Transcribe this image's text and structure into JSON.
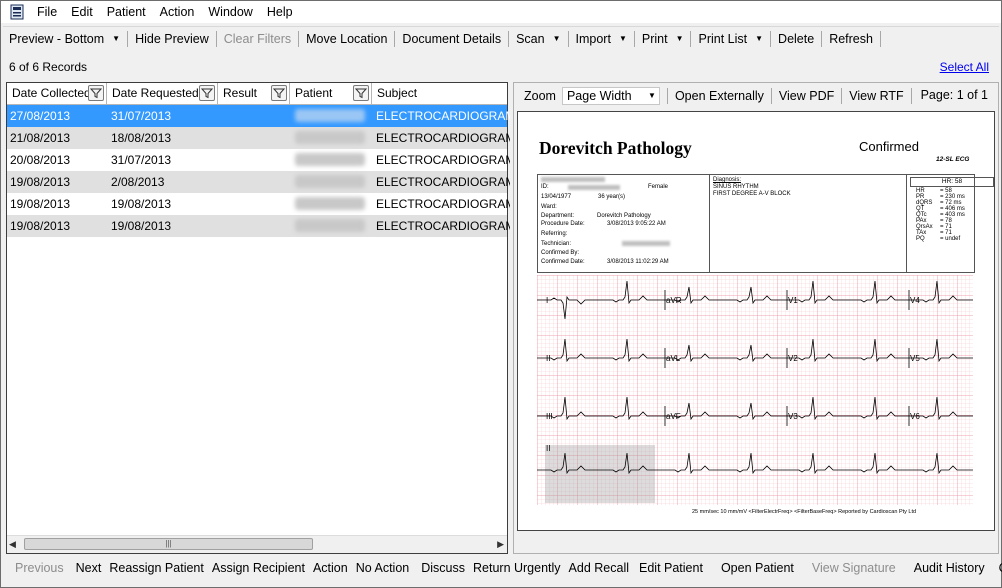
{
  "menu": [
    "File",
    "Edit",
    "Patient",
    "Action",
    "Window",
    "Help"
  ],
  "toolbar": {
    "preview": "Preview - Bottom",
    "hide_preview": "Hide Preview",
    "clear_filters": "Clear Filters",
    "move_location": "Move Location",
    "document_details": "Document Details",
    "scan": "Scan",
    "import": "Import",
    "print": "Print",
    "print_list": "Print List",
    "delete": "Delete",
    "refresh": "Refresh"
  },
  "records": {
    "count": "6 of 6 Records",
    "select_all": "Select All"
  },
  "grid": {
    "columns": [
      "Date Collected",
      "Date Requested",
      "Result",
      "Patient",
      "Subject"
    ],
    "rows": [
      {
        "collected": "27/08/2013",
        "requested": "31/07/2013",
        "result": "",
        "subject": "ELECTROCARDIOGRAM"
      },
      {
        "collected": "21/08/2013",
        "requested": "18/08/2013",
        "result": "",
        "subject": "ELECTROCARDIOGRAM"
      },
      {
        "collected": "20/08/2013",
        "requested": "31/07/2013",
        "result": "",
        "subject": "ELECTROCARDIOGRAM"
      },
      {
        "collected": "19/08/2013",
        "requested": "2/08/2013",
        "result": "",
        "subject": "ELECTROCARDIOGRAM"
      },
      {
        "collected": "19/08/2013",
        "requested": "19/08/2013",
        "result": "",
        "subject": "ELECTROCARDIOGRAM"
      },
      {
        "collected": "19/08/2013",
        "requested": "19/08/2013",
        "result": "",
        "subject": "ELECTROCARDIOGRAM"
      }
    ]
  },
  "viewer": {
    "zoom_label": "Zoom",
    "zoom_value": "Page Width",
    "open_externally": "Open Externally",
    "view_pdf": "View PDF",
    "view_rtf": "View RTF",
    "page": "Page: 1 of 1"
  },
  "report": {
    "title": "Dorevitch Pathology",
    "status": "Confirmed",
    "type": "12-SL ECG",
    "dob": "13/04/1977",
    "age": "36 year(s)",
    "sex": "Female",
    "id_label": "ID:",
    "ward_label": "Ward:",
    "department_label": "Department:",
    "department": "Dorevitch Pathology",
    "procedure_label": "Procedure Date:",
    "procedure_date": "3/08/2013 9:05:22 AM",
    "referring_label": "Referring:",
    "technician_label": "Technician:",
    "confirmed_by_label": "Confirmed By:",
    "confirmed_date_label": "Confirmed Date:",
    "confirmed_date": "3/08/2013 11:02:29 AM",
    "diagnosis_label": "Diagnosis:",
    "diagnosis": [
      "SINUS RHYTHM",
      "FIRST DEGREE A-V BLOCK"
    ],
    "hr_header": "HR: 58",
    "measures": [
      [
        "HR",
        "= 58"
      ],
      [
        "PR",
        "= 230 ms"
      ],
      [
        "dQRS",
        "= 72 ms"
      ],
      [
        "QT",
        "= 406 ms"
      ],
      [
        "QTc",
        "= 403 ms"
      ],
      [
        "PAx",
        "= 78"
      ],
      [
        "QrsAx",
        "= 71"
      ],
      [
        "TAx",
        "= 71"
      ],
      [
        "PQ",
        "= undef"
      ]
    ],
    "leads": [
      "I",
      "aVR",
      "V1",
      "V4",
      "II",
      "aVL",
      "V2",
      "V5",
      "III",
      "aVF",
      "V3",
      "V6",
      "II"
    ],
    "footer": "25 mm/sec  10 mm/mV  <FilterElectrFreq>  <FilterBaseFreq> Reported by Cardioscan Pty Ltd"
  },
  "bottom": {
    "previous": "Previous",
    "next": "Next",
    "reassign": "Reassign Patient",
    "assign_recipient": "Assign Recipient",
    "action": "Action",
    "no_action": "No Action",
    "discuss": "Discuss",
    "return_urgently": "Return Urgently",
    "add_recall": "Add Recall",
    "edit_patient": "Edit Patient",
    "open_patient": "Open Patient",
    "view_signature": "View Signature",
    "audit_history": "Audit History",
    "close": "Close"
  }
}
